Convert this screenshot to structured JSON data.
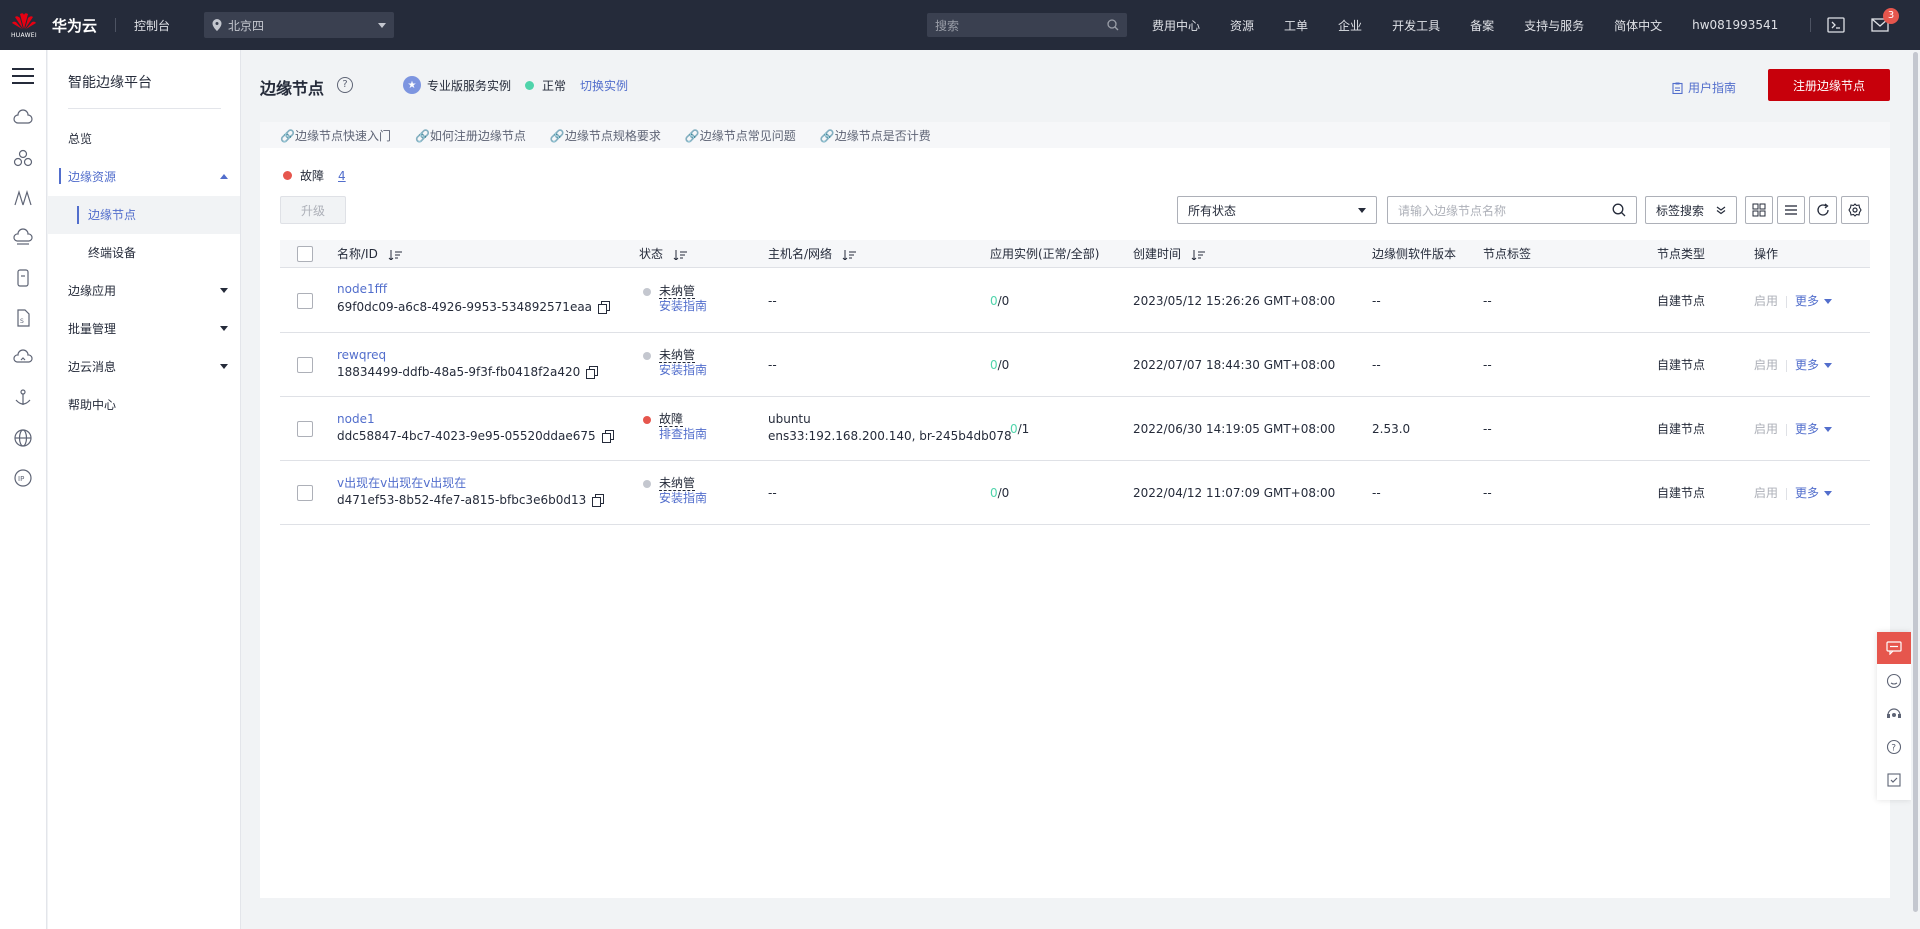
{
  "topbar": {
    "logo_word": "HUAWEI",
    "brand": "华为云",
    "console": "控制台",
    "region": "北京四",
    "search_placeholder": "搜索",
    "nav": [
      "费用中心",
      "资源",
      "工单",
      "企业",
      "开发工具",
      "备案",
      "支持与服务",
      "简体中文",
      "hw081993541"
    ],
    "message_badge": "3"
  },
  "sidebar": {
    "title": "智能边缘平台",
    "items": {
      "overview": "总览",
      "edge_resources": "边缘资源",
      "edge_nodes": "边缘节点",
      "terminal_devices": "终端设备",
      "edge_apps": "边缘应用",
      "batch_mgmt": "批量管理",
      "edge_cloud_msg": "边云消息",
      "help_center": "帮助中心"
    }
  },
  "header": {
    "title": "边缘节点",
    "help": "?",
    "instance_label": "专业版服务实例",
    "instance_status": "正常",
    "switch_instance": "切换实例",
    "user_guide": "用户指南",
    "register_button": "注册边缘节点"
  },
  "quick_links": [
    "🔗边缘节点快速入门",
    "🔗如何注册边缘节点",
    "🔗边缘节点规格要求",
    "🔗边缘节点常见问题",
    "🔗边缘节点是否计费"
  ],
  "toolbar": {
    "fault_label": "故障",
    "fault_count": "4",
    "upgrade": "升级",
    "status_filter": "所有状态",
    "search_placeholder": "请输入边缘节点名称",
    "tag_search": "标签搜索"
  },
  "table": {
    "headers": {
      "name": "名称/ID",
      "status": "状态",
      "host": "主机名/网络",
      "apps": "应用实例(正常/全部)",
      "created": "创建时间",
      "version": "边缘侧软件版本",
      "tags": "节点标签",
      "type": "节点类型",
      "ops": "操作"
    },
    "rows": [
      {
        "name": "node1fff",
        "id": "69f0dc09-a6c8-4926-9953-534892571eaa",
        "status": "未纳管",
        "status_link": "安装指南",
        "host": "--",
        "net": "",
        "apps_ok": "0",
        "apps_total": "/0",
        "created": "2023/05/12 15:26:26 GMT+08:00",
        "version": "--",
        "tags": "--",
        "type": "自建节点",
        "enable": "启用",
        "more": "更多"
      },
      {
        "name": "rewqreq",
        "id": "18834499-ddfb-48a5-9f3f-fb0418f2a420",
        "status": "未纳管",
        "status_link": "安装指南",
        "host": "--",
        "net": "",
        "apps_ok": "0",
        "apps_total": "/0",
        "created": "2022/07/07 18:44:30 GMT+08:00",
        "version": "--",
        "tags": "--",
        "type": "自建节点",
        "enable": "启用",
        "more": "更多"
      },
      {
        "name": "node1",
        "id": "ddc58847-4bc7-4023-9e95-05520ddae675",
        "status": "故障",
        "status_link": "排查指南",
        "host": "ubuntu",
        "net": "ens33:192.168.200.140, br-245b4db078",
        "apps_ok": "0",
        "apps_total": "/1",
        "created": "2022/06/30 14:19:05 GMT+08:00",
        "version": "2.53.0",
        "tags": "--",
        "type": "自建节点",
        "enable": "启用",
        "more": "更多"
      },
      {
        "name": "v出现在v出现在v出现在",
        "id": "d471ef53-8b52-4fe7-a815-bfbc3e6b0d13",
        "status": "未纳管",
        "status_link": "安装指南",
        "host": "--",
        "net": "",
        "apps_ok": "0",
        "apps_total": "/0",
        "created": "2022/04/12 11:07:09 GMT+08:00",
        "version": "--",
        "tags": "--",
        "type": "自建节点",
        "enable": "启用",
        "more": "更多"
      }
    ]
  },
  "colors": {
    "topbar_bg": "#252b3a",
    "accent": "#526ecc",
    "brand_red": "#c7000b",
    "fault": "#e6564d",
    "ok_green": "#50d4ab",
    "unmanaged_gray": "#c4c7cf"
  },
  "icons": {
    "rail": [
      "menu-icon",
      "cloud-icon",
      "cluster-icon",
      "bridge-icon",
      "cloud-disk-icon",
      "device-icon",
      "file-icon",
      "cloud-upload-icon",
      "anchor-icon",
      "globe-icon",
      "ip-icon"
    ],
    "float": [
      "chat-icon",
      "feedback-icon",
      "service-icon",
      "help-icon",
      "checklist-icon"
    ]
  }
}
